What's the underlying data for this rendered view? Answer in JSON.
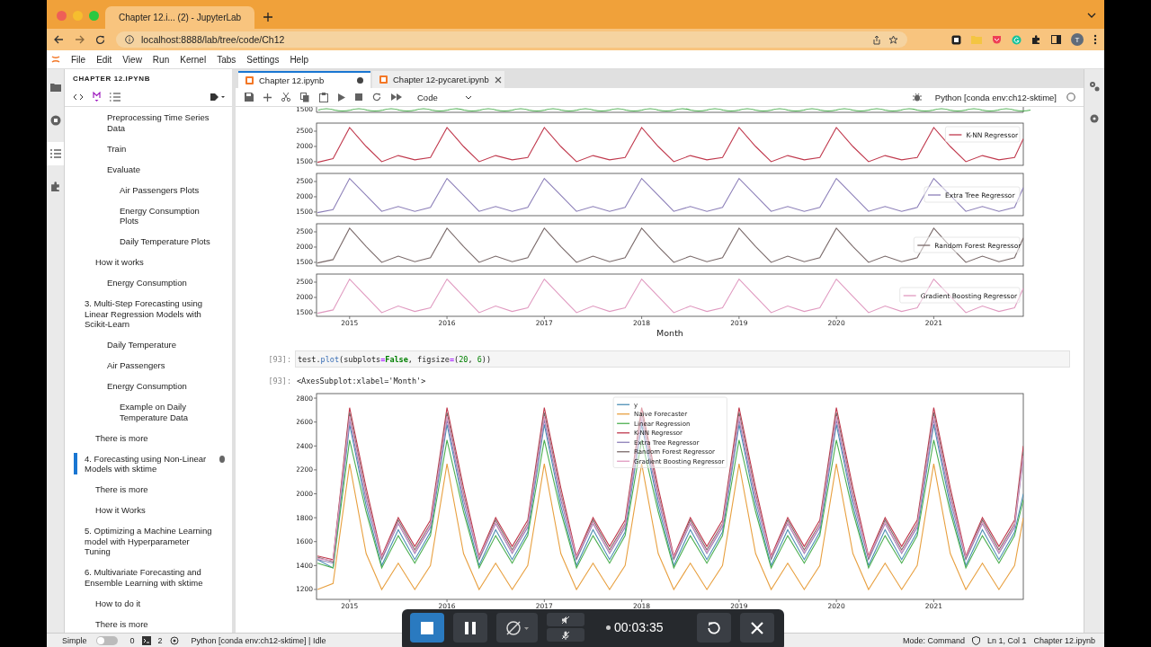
{
  "browser": {
    "tab_title": "Chapter 12.i... (2) - JupyterLab",
    "url": "localhost:8888/lab/tree/code/Ch12",
    "profile_initial": "T"
  },
  "menu": [
    "File",
    "Edit",
    "View",
    "Run",
    "Kernel",
    "Tabs",
    "Settings",
    "Help"
  ],
  "activity_bar": [
    {
      "kind": "folder",
      "selected": false
    },
    {
      "kind": "running",
      "selected": false
    },
    {
      "kind": "toc",
      "selected": true
    },
    {
      "kind": "extensions",
      "selected": false
    }
  ],
  "toc": {
    "title": "CHAPTER 12.IPYNB",
    "items": [
      {
        "children": [
          {
            "children": [
              {
                "text": "Preprocessing Time Series Data",
                "selected": false
              },
              {
                "text": "Train",
                "selected": false
              },
              {
                "text": "Evaluate",
                "selected": false,
                "children": [
                  {
                    "text": "Air Passengers Plots",
                    "selected": false
                  },
                  {
                    "text": "Energy Consumption Plots",
                    "selected": false
                  },
                  {
                    "text": "Daily Temperature Plots",
                    "selected": false
                  }
                ]
              }
            ]
          },
          {
            "text": "How it works",
            "selected": false,
            "children": [
              {
                "text": "Energy Consumption",
                "selected": false
              }
            ]
          }
        ]
      },
      {
        "text": "3. Multi-Step Forecasting using Linear Regression Models with Scikit-Learn",
        "selected": false,
        "children": [
          {
            "children": [
              {
                "text": "Daily Temperature",
                "selected": false
              },
              {
                "text": "Air Passengers",
                "selected": false
              },
              {
                "text": "Energy Consumption",
                "selected": false,
                "children": [
                  {
                    "text": "Example on Daily Temperature Data",
                    "selected": false
                  }
                ]
              }
            ]
          },
          {
            "text": "There is more",
            "selected": false
          }
        ]
      },
      {
        "text": "4. Forecasting using Non-Linear Models with sktime",
        "selected": true,
        "children": [
          {
            "text": "There is more",
            "selected": false
          },
          {
            "text": "How it Works",
            "selected": false
          }
        ]
      },
      {
        "text": "5. Optimizing a Machine Learning model with Hyperparameter Tuning",
        "selected": false
      },
      {
        "text": "6. Multivariate Forecasting and Ensemble Learning with sktime",
        "selected": false,
        "children": [
          {
            "text": "How to do it",
            "selected": false
          },
          {
            "text": "There is more",
            "selected": false
          }
        ]
      }
    ]
  },
  "tabs": [
    {
      "label": "Chapter 12.ipynb",
      "selected": true,
      "modified": true
    },
    {
      "label": "Chapter 12-pycaret.ipynb",
      "selected": false,
      "modified": false
    }
  ],
  "toolbar": {
    "cell_type": "Code",
    "kernel": "Python [conda env:ch12-sktime]"
  },
  "notebook": {
    "figure": {
      "subplots": [
        {
          "kind": "clipped",
          "tick_label": "1500"
        },
        {
          "kind": "full",
          "chart_data": {
            "type": "line",
            "legend": "upper right",
            "x": [
              2014.67,
              2014.83,
              2015,
              2015.17,
              2015.33,
              2015.5,
              2015.67,
              2015.83,
              2016,
              2016.17,
              2016.33,
              2016.5,
              2016.67,
              2016.83,
              2017,
              2017.17,
              2017.33,
              2017.5,
              2017.67,
              2017.83,
              2018,
              2018.17,
              2018.33,
              2018.5,
              2018.67,
              2018.83,
              2019,
              2019.17,
              2019.33,
              2019.5,
              2019.67,
              2019.83,
              2020,
              2020.17,
              2020.33,
              2020.5,
              2020.67,
              2020.83,
              2021,
              2021.17,
              2021.33,
              2021.5,
              2021.67,
              2021.83,
              2021.92
            ],
            "xlim": [
              2014.66,
              2021.92
            ],
            "ylim": [
              1380,
              2765
            ],
            "yticks": [
              1500,
              2000,
              2500
            ],
            "series": [
              {
                "name": "K-NN Regressor",
                "color": "#c0394d",
                "values": [
                  1480,
                  1600,
                  2620,
                  2000,
                  1500,
                  1700,
                  1560,
                  1640,
                  2620,
                  2000,
                  1500,
                  1700,
                  1560,
                  1640,
                  2620,
                  2000,
                  1500,
                  1700,
                  1560,
                  1640,
                  2620,
                  2000,
                  1500,
                  1700,
                  1560,
                  1640,
                  2620,
                  2000,
                  1500,
                  1700,
                  1560,
                  1640,
                  2620,
                  2000,
                  1500,
                  1700,
                  1560,
                  1640,
                  2620,
                  2000,
                  1500,
                  1700,
                  1560,
                  1640,
                  2250
                ]
              }
            ]
          }
        },
        {
          "kind": "full",
          "chart_data": {
            "type": "line",
            "legend": "center right",
            "x": [
              2014.67,
              2014.83,
              2015,
              2015.17,
              2015.33,
              2015.5,
              2015.67,
              2015.83,
              2016,
              2016.17,
              2016.33,
              2016.5,
              2016.67,
              2016.83,
              2017,
              2017.17,
              2017.33,
              2017.5,
              2017.67,
              2017.83,
              2018,
              2018.17,
              2018.33,
              2018.5,
              2018.67,
              2018.83,
              2019,
              2019.17,
              2019.33,
              2019.5,
              2019.67,
              2019.83,
              2020,
              2020.17,
              2020.33,
              2020.5,
              2020.67,
              2020.83,
              2021,
              2021.17,
              2021.33,
              2021.5,
              2021.67,
              2021.83,
              2021.92
            ],
            "xlim": [
              2014.66,
              2021.92
            ],
            "ylim": [
              1380,
              2765
            ],
            "yticks": [
              1500,
              2000,
              2500
            ],
            "series": [
              {
                "name": "Extra Tree Regressor",
                "color": "#8c7fb8",
                "values": [
                  1480,
                  1580,
                  2600,
                  2050,
                  1520,
                  1680,
                  1520,
                  1650,
                  2600,
                  2050,
                  1520,
                  1680,
                  1520,
                  1650,
                  2600,
                  2050,
                  1520,
                  1680,
                  1520,
                  1650,
                  2600,
                  2050,
                  1520,
                  1680,
                  1520,
                  1650,
                  2600,
                  2050,
                  1520,
                  1680,
                  1520,
                  1650,
                  2600,
                  2050,
                  1520,
                  1680,
                  1520,
                  1650,
                  2600,
                  2050,
                  1520,
                  1680,
                  1520,
                  1650,
                  2300
                ]
              }
            ]
          }
        },
        {
          "kind": "full",
          "chart_data": {
            "type": "line",
            "legend": "center right",
            "x": [
              2014.67,
              2014.83,
              2015,
              2015.17,
              2015.33,
              2015.5,
              2015.67,
              2015.83,
              2016,
              2016.17,
              2016.33,
              2016.5,
              2016.67,
              2016.83,
              2017,
              2017.17,
              2017.33,
              2017.5,
              2017.67,
              2017.83,
              2018,
              2018.17,
              2018.33,
              2018.5,
              2018.67,
              2018.83,
              2019,
              2019.17,
              2019.33,
              2019.5,
              2019.67,
              2019.83,
              2020,
              2020.17,
              2020.33,
              2020.5,
              2020.67,
              2020.83,
              2021,
              2021.17,
              2021.33,
              2021.5,
              2021.67,
              2021.83,
              2021.92
            ],
            "xlim": [
              2014.66,
              2021.92
            ],
            "ylim": [
              1380,
              2765
            ],
            "yticks": [
              1500,
              2000,
              2500
            ],
            "series": [
              {
                "name": "Random Forest Regressor",
                "color": "#7a6a6a",
                "values": [
                  1480,
                  1590,
                  2620,
                  2020,
                  1500,
                  1700,
                  1520,
                  1650,
                  2620,
                  2020,
                  1500,
                  1700,
                  1520,
                  1650,
                  2620,
                  2020,
                  1500,
                  1700,
                  1520,
                  1650,
                  2620,
                  2020,
                  1500,
                  1700,
                  1520,
                  1650,
                  2620,
                  2020,
                  1500,
                  1700,
                  1520,
                  1650,
                  2620,
                  2020,
                  1500,
                  1700,
                  1520,
                  1650,
                  2620,
                  2020,
                  1500,
                  1700,
                  1520,
                  1650,
                  2300
                ]
              }
            ]
          }
        },
        {
          "kind": "full",
          "chart_data": {
            "type": "line",
            "legend": "center right",
            "xlabel": "Month",
            "x": [
              2014.67,
              2014.83,
              2015,
              2015.17,
              2015.33,
              2015.5,
              2015.67,
              2015.83,
              2016,
              2016.17,
              2016.33,
              2016.5,
              2016.67,
              2016.83,
              2017,
              2017.17,
              2017.33,
              2017.5,
              2017.67,
              2017.83,
              2018,
              2018.17,
              2018.33,
              2018.5,
              2018.67,
              2018.83,
              2019,
              2019.17,
              2019.33,
              2019.5,
              2019.67,
              2019.83,
              2020,
              2020.17,
              2020.33,
              2020.5,
              2020.67,
              2020.83,
              2021,
              2021.17,
              2021.33,
              2021.5,
              2021.67,
              2021.83,
              2021.92
            ],
            "xlim": [
              2014.66,
              2021.92
            ],
            "ylim": [
              1380,
              2765
            ],
            "xticks": [
              2015,
              2016,
              2017,
              2018,
              2019,
              2020,
              2021
            ],
            "yticks": [
              1500,
              2000,
              2500
            ],
            "series": [
              {
                "name": "Gradient Boosting Regressor",
                "color": "#e09ac0",
                "values": [
                  1480,
                  1590,
                  2600,
                  2030,
                  1500,
                  1720,
                  1540,
                  1660,
                  2600,
                  2030,
                  1500,
                  1720,
                  1540,
                  1660,
                  2600,
                  2030,
                  1500,
                  1720,
                  1540,
                  1660,
                  2600,
                  2030,
                  1500,
                  1720,
                  1540,
                  1660,
                  2600,
                  2030,
                  1500,
                  1720,
                  1540,
                  1660,
                  2600,
                  2030,
                  1500,
                  1720,
                  1540,
                  1660,
                  2600,
                  2030,
                  1500,
                  1720,
                  1540,
                  1660,
                  2300
                ]
              }
            ]
          }
        }
      ]
    },
    "cell": {
      "prompt": "[93]:",
      "code": [
        {
          "kind": "plain",
          "text": "test."
        },
        {
          "kind": "name",
          "text": "plot"
        },
        {
          "kind": "plain",
          "text": "(subplots"
        },
        {
          "kind": "op",
          "text": "="
        },
        {
          "kind": "keyword",
          "text": "False"
        },
        {
          "kind": "plain",
          "text": ", figsize"
        },
        {
          "kind": "op",
          "text": "="
        },
        {
          "kind": "plain",
          "text": "("
        },
        {
          "kind": "number",
          "text": "20"
        },
        {
          "kind": "plain",
          "text": ", "
        },
        {
          "kind": "number",
          "text": "6"
        },
        {
          "kind": "plain",
          "text": "))"
        }
      ],
      "output_prompt": "[93]:",
      "output_text": "<AxesSubplot:xlabel='Month'>",
      "chart_data": {
        "type": "line",
        "legend": "upper center",
        "x": [
          2014.67,
          2014.83,
          2015,
          2015.17,
          2015.33,
          2015.5,
          2015.67,
          2015.83,
          2016,
          2016.17,
          2016.33,
          2016.5,
          2016.67,
          2016.83,
          2017,
          2017.17,
          2017.33,
          2017.5,
          2017.67,
          2017.83,
          2018,
          2018.17,
          2018.33,
          2018.5,
          2018.67,
          2018.83,
          2019,
          2019.17,
          2019.33,
          2019.5,
          2019.67,
          2019.83,
          2020,
          2020.17,
          2020.33,
          2020.5,
          2020.67,
          2020.83,
          2021,
          2021.17,
          2021.33,
          2021.5,
          2021.67,
          2021.83,
          2021.92
        ],
        "xlim": [
          2014.66,
          2021.92
        ],
        "ylim": [
          1117,
          2838
        ],
        "xticks": [
          2015,
          2016,
          2017,
          2018,
          2019,
          2020,
          2021
        ],
        "yticks": [
          1200,
          1400,
          1600,
          1800,
          2000,
          2200,
          2400,
          2600,
          2800
        ],
        "series": [
          {
            "name": "y",
            "color": "#4c8fb5",
            "values": [
              1450,
              1380,
              2580,
              1900,
              1400,
              1700,
              1450,
              1680,
              2580,
              1900,
              1400,
              1700,
              1450,
              1680,
              2580,
              1900,
              1400,
              1700,
              1450,
              1680,
              2580,
              1900,
              1400,
              1700,
              1450,
              1680,
              2580,
              1900,
              1400,
              1700,
              1450,
              1680,
              2580,
              1900,
              1400,
              1700,
              1450,
              1680,
              2580,
              1900,
              1400,
              1700,
              1450,
              1680,
              2000
            ]
          },
          {
            "name": "Naive Forecaster",
            "color": "#e8a040",
            "values": [
              1200,
              1250,
              2250,
              1500,
              1200,
              1420,
              1200,
              1400,
              2250,
              1500,
              1200,
              1420,
              1200,
              1400,
              2250,
              1500,
              1200,
              1420,
              1200,
              1400,
              2250,
              1500,
              1200,
              1420,
              1200,
              1400,
              2250,
              1500,
              1200,
              1420,
              1200,
              1400,
              2250,
              1500,
              1200,
              1420,
              1200,
              1400,
              2250,
              1500,
              1200,
              1420,
              1200,
              1400,
              1800
            ]
          },
          {
            "name": "Linear Regression",
            "color": "#4caf50",
            "values": [
              1420,
              1380,
              2450,
              1850,
              1380,
              1650,
              1420,
              1650,
              2450,
              1850,
              1380,
              1650,
              1420,
              1650,
              2450,
              1850,
              1380,
              1650,
              1420,
              1650,
              2450,
              1850,
              1380,
              1650,
              1420,
              1650,
              2450,
              1850,
              1380,
              1650,
              1420,
              1650,
              2450,
              1850,
              1380,
              1650,
              1420,
              1650,
              2450,
              1850,
              1380,
              1650,
              1420,
              1650,
              1950
            ]
          },
          {
            "name": "K-NN Regressor",
            "color": "#c0394d",
            "values": [
              1480,
              1450,
              2720,
              2050,
              1480,
              1800,
              1560,
              1780,
              2720,
              2050,
              1480,
              1800,
              1560,
              1780,
              2720,
              2050,
              1480,
              1800,
              1560,
              1780,
              2720,
              2050,
              1480,
              1800,
              1560,
              1780,
              2720,
              2050,
              1480,
              1800,
              1560,
              1780,
              2720,
              2050,
              1480,
              1800,
              1560,
              1780,
              2720,
              2050,
              1480,
              1800,
              1560,
              1780,
              2400
            ]
          },
          {
            "name": "Extra Tree Regressor",
            "color": "#8c7fb8",
            "values": [
              1450,
              1420,
              2620,
              1950,
              1450,
              1750,
              1500,
              1720,
              2620,
              1950,
              1450,
              1750,
              1500,
              1720,
              2620,
              1950,
              1450,
              1750,
              1500,
              1720,
              2620,
              1950,
              1450,
              1750,
              1500,
              1720,
              2620,
              1950,
              1450,
              1750,
              1500,
              1720,
              2620,
              1950,
              1450,
              1750,
              1500,
              1720,
              2620,
              1950,
              1450,
              1750,
              1500,
              1720,
              2300
            ]
          },
          {
            "name": "Random Forest Regressor",
            "color": "#7a6a6a",
            "values": [
              1470,
              1430,
              2680,
              2000,
              1460,
              1780,
              1530,
              1750,
              2680,
              2000,
              1460,
              1780,
              1530,
              1750,
              2680,
              2000,
              1460,
              1780,
              1530,
              1750,
              2680,
              2000,
              1460,
              1780,
              1530,
              1750,
              2680,
              2000,
              1460,
              1780,
              1530,
              1750,
              2680,
              2000,
              1460,
              1780,
              1530,
              1750,
              2680,
              2000,
              1460,
              1780,
              1530,
              1750,
              2350
            ]
          },
          {
            "name": "Gradient Boosting Regressor",
            "color": "#e09ac0",
            "values": [
              1460,
              1440,
              2650,
              1980,
              1470,
              1760,
              1510,
              1740,
              2650,
              1980,
              1470,
              1760,
              1510,
              1740,
              2650,
              1980,
              1470,
              1760,
              1510,
              1740,
              2650,
              1980,
              1470,
              1760,
              1510,
              1740,
              2650,
              1980,
              1470,
              1760,
              1510,
              1740,
              2650,
              1980,
              1470,
              1760,
              1510,
              1740,
              2650,
              1980,
              1470,
              1760,
              1510,
              1740,
              2320
            ]
          }
        ]
      }
    }
  },
  "status_bar": {
    "mode_label": "Simple",
    "simple_mode": false,
    "terminals": "0",
    "kernels": "2",
    "kernel_status": "Python [conda env:ch12-sktime] | Idle",
    "mode": "Mode: Command",
    "position": "Ln 1, Col 1",
    "file": "Chapter 12.ipynb"
  },
  "recorder": {
    "elapsed": "00:03:35"
  }
}
